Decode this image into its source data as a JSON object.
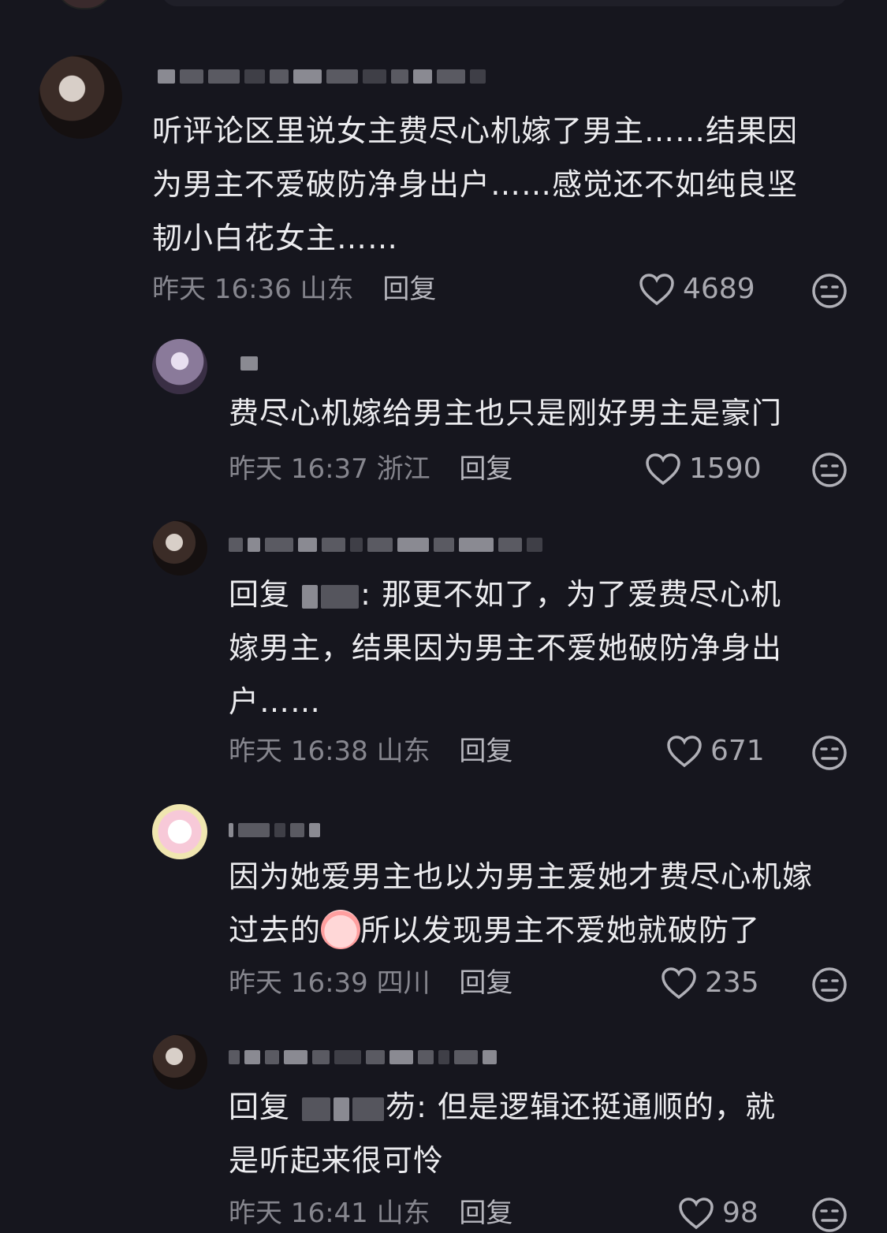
{
  "comments": [
    {
      "text": "听评论区里说女主费尽心机嫁了男主……结果因\n为男主不爱破防净身出户……感觉还不如纯良坚\n韧小白花女主……",
      "time": "昨天 16:36",
      "location": "山东",
      "reply_label": "回复",
      "likes": "4689"
    },
    {
      "text": "费尽心机嫁给男主也只是刚好男主是豪门",
      "time": "昨天 16:37",
      "location": "浙江",
      "reply_label": "回复",
      "likes": "1590"
    },
    {
      "reply_prefix": "回复",
      "text_after_name": ": 那更不如了，为了爱费尽心机",
      "text_rest": "嫁男主，结果因为男主不爱她破防净身出\n户……",
      "time": "昨天 16:38",
      "location": "山东",
      "reply_label": "回复",
      "likes": "671"
    },
    {
      "text_line1": "因为她爱男主也以为男主爱她才费尽心机嫁",
      "text_line2a": "过去的",
      "text_line2b": "所以发现男主不爱她就破防了",
      "time": "昨天 16:39",
      "location": "四川",
      "reply_label": "回复",
      "likes": "235"
    },
    {
      "reply_prefix": "回复",
      "text_after_name": "芴: 但是逻辑还挺通顺的，就",
      "text_rest": "是听起来很可怜",
      "time": "昨天 16:41",
      "location": "山东",
      "reply_label": "回复",
      "likes": "98"
    }
  ],
  "icons": {
    "like": "heart-outline-icon",
    "dislike": "neutral-face-icon",
    "emoji": "crying-face-emoji"
  },
  "colors": {
    "background": "#16161e",
    "text": "#ececef",
    "meta": "#86868e"
  }
}
